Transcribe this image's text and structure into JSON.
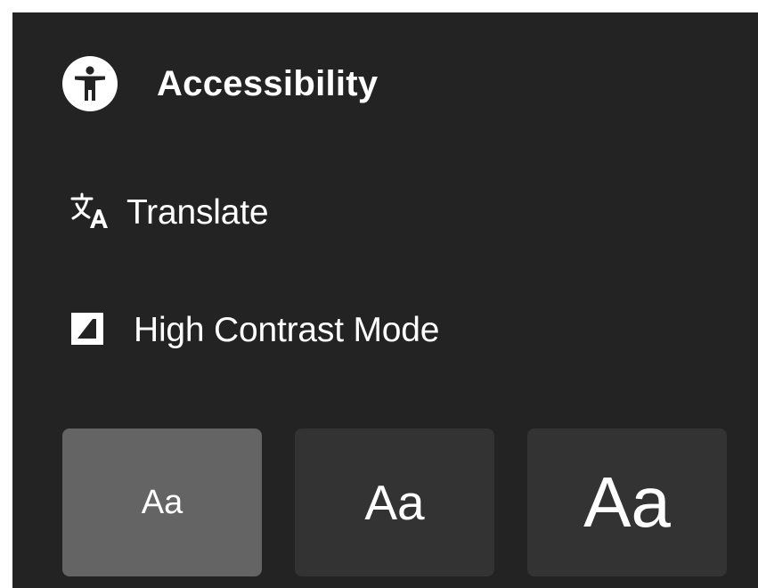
{
  "header": {
    "icon": "accessibility-icon",
    "title": "Accessibility"
  },
  "menu": {
    "translate": {
      "icon": "translate-icon",
      "label": "Translate"
    },
    "high_contrast": {
      "icon": "contrast-icon",
      "label": "High Contrast Mode"
    }
  },
  "text_size": {
    "options": [
      {
        "label": "Aa",
        "size": "small",
        "selected": true
      },
      {
        "label": "Aa",
        "size": "medium",
        "selected": false
      },
      {
        "label": "Aa",
        "size": "large",
        "selected": false
      }
    ]
  },
  "colors": {
    "panel_background": "#232323",
    "button_background": "#333333",
    "selected_button_background": "#646464",
    "text": "#ffffff"
  }
}
